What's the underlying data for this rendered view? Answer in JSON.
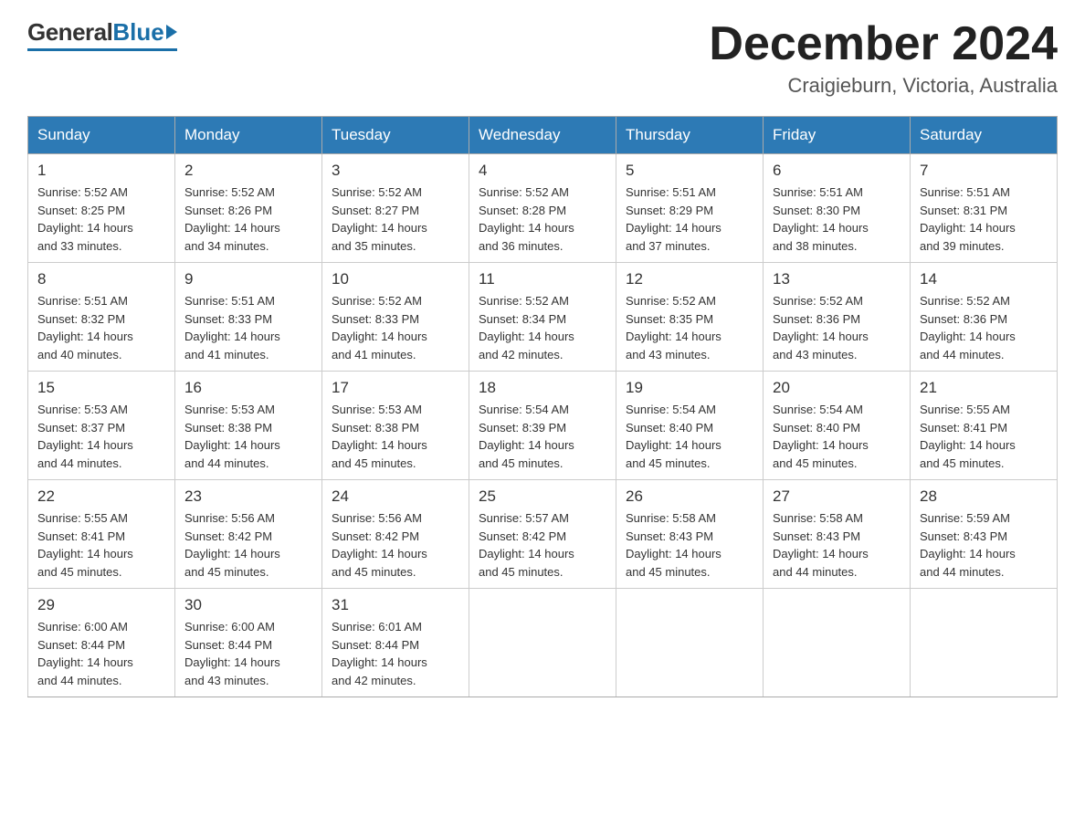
{
  "logo": {
    "general": "General",
    "blue": "Blue",
    "tagline": ""
  },
  "title": "December 2024",
  "location": "Craigieburn, Victoria, Australia",
  "days_of_week": [
    "Sunday",
    "Monday",
    "Tuesday",
    "Wednesday",
    "Thursday",
    "Friday",
    "Saturday"
  ],
  "weeks": [
    [
      {
        "day": 1,
        "sunrise": "5:52 AM",
        "sunset": "8:25 PM",
        "daylight": "14 hours and 33 minutes."
      },
      {
        "day": 2,
        "sunrise": "5:52 AM",
        "sunset": "8:26 PM",
        "daylight": "14 hours and 34 minutes."
      },
      {
        "day": 3,
        "sunrise": "5:52 AM",
        "sunset": "8:27 PM",
        "daylight": "14 hours and 35 minutes."
      },
      {
        "day": 4,
        "sunrise": "5:52 AM",
        "sunset": "8:28 PM",
        "daylight": "14 hours and 36 minutes."
      },
      {
        "day": 5,
        "sunrise": "5:51 AM",
        "sunset": "8:29 PM",
        "daylight": "14 hours and 37 minutes."
      },
      {
        "day": 6,
        "sunrise": "5:51 AM",
        "sunset": "8:30 PM",
        "daylight": "14 hours and 38 minutes."
      },
      {
        "day": 7,
        "sunrise": "5:51 AM",
        "sunset": "8:31 PM",
        "daylight": "14 hours and 39 minutes."
      }
    ],
    [
      {
        "day": 8,
        "sunrise": "5:51 AM",
        "sunset": "8:32 PM",
        "daylight": "14 hours and 40 minutes."
      },
      {
        "day": 9,
        "sunrise": "5:51 AM",
        "sunset": "8:33 PM",
        "daylight": "14 hours and 41 minutes."
      },
      {
        "day": 10,
        "sunrise": "5:52 AM",
        "sunset": "8:33 PM",
        "daylight": "14 hours and 41 minutes."
      },
      {
        "day": 11,
        "sunrise": "5:52 AM",
        "sunset": "8:34 PM",
        "daylight": "14 hours and 42 minutes."
      },
      {
        "day": 12,
        "sunrise": "5:52 AM",
        "sunset": "8:35 PM",
        "daylight": "14 hours and 43 minutes."
      },
      {
        "day": 13,
        "sunrise": "5:52 AM",
        "sunset": "8:36 PM",
        "daylight": "14 hours and 43 minutes."
      },
      {
        "day": 14,
        "sunrise": "5:52 AM",
        "sunset": "8:36 PM",
        "daylight": "14 hours and 44 minutes."
      }
    ],
    [
      {
        "day": 15,
        "sunrise": "5:53 AM",
        "sunset": "8:37 PM",
        "daylight": "14 hours and 44 minutes."
      },
      {
        "day": 16,
        "sunrise": "5:53 AM",
        "sunset": "8:38 PM",
        "daylight": "14 hours and 44 minutes."
      },
      {
        "day": 17,
        "sunrise": "5:53 AM",
        "sunset": "8:38 PM",
        "daylight": "14 hours and 45 minutes."
      },
      {
        "day": 18,
        "sunrise": "5:54 AM",
        "sunset": "8:39 PM",
        "daylight": "14 hours and 45 minutes."
      },
      {
        "day": 19,
        "sunrise": "5:54 AM",
        "sunset": "8:40 PM",
        "daylight": "14 hours and 45 minutes."
      },
      {
        "day": 20,
        "sunrise": "5:54 AM",
        "sunset": "8:40 PM",
        "daylight": "14 hours and 45 minutes."
      },
      {
        "day": 21,
        "sunrise": "5:55 AM",
        "sunset": "8:41 PM",
        "daylight": "14 hours and 45 minutes."
      }
    ],
    [
      {
        "day": 22,
        "sunrise": "5:55 AM",
        "sunset": "8:41 PM",
        "daylight": "14 hours and 45 minutes."
      },
      {
        "day": 23,
        "sunrise": "5:56 AM",
        "sunset": "8:42 PM",
        "daylight": "14 hours and 45 minutes."
      },
      {
        "day": 24,
        "sunrise": "5:56 AM",
        "sunset": "8:42 PM",
        "daylight": "14 hours and 45 minutes."
      },
      {
        "day": 25,
        "sunrise": "5:57 AM",
        "sunset": "8:42 PM",
        "daylight": "14 hours and 45 minutes."
      },
      {
        "day": 26,
        "sunrise": "5:58 AM",
        "sunset": "8:43 PM",
        "daylight": "14 hours and 45 minutes."
      },
      {
        "day": 27,
        "sunrise": "5:58 AM",
        "sunset": "8:43 PM",
        "daylight": "14 hours and 44 minutes."
      },
      {
        "day": 28,
        "sunrise": "5:59 AM",
        "sunset": "8:43 PM",
        "daylight": "14 hours and 44 minutes."
      }
    ],
    [
      {
        "day": 29,
        "sunrise": "6:00 AM",
        "sunset": "8:44 PM",
        "daylight": "14 hours and 44 minutes."
      },
      {
        "day": 30,
        "sunrise": "6:00 AM",
        "sunset": "8:44 PM",
        "daylight": "14 hours and 43 minutes."
      },
      {
        "day": 31,
        "sunrise": "6:01 AM",
        "sunset": "8:44 PM",
        "daylight": "14 hours and 42 minutes."
      },
      null,
      null,
      null,
      null
    ]
  ],
  "labels": {
    "sunrise": "Sunrise:",
    "sunset": "Sunset:",
    "daylight": "Daylight:"
  }
}
